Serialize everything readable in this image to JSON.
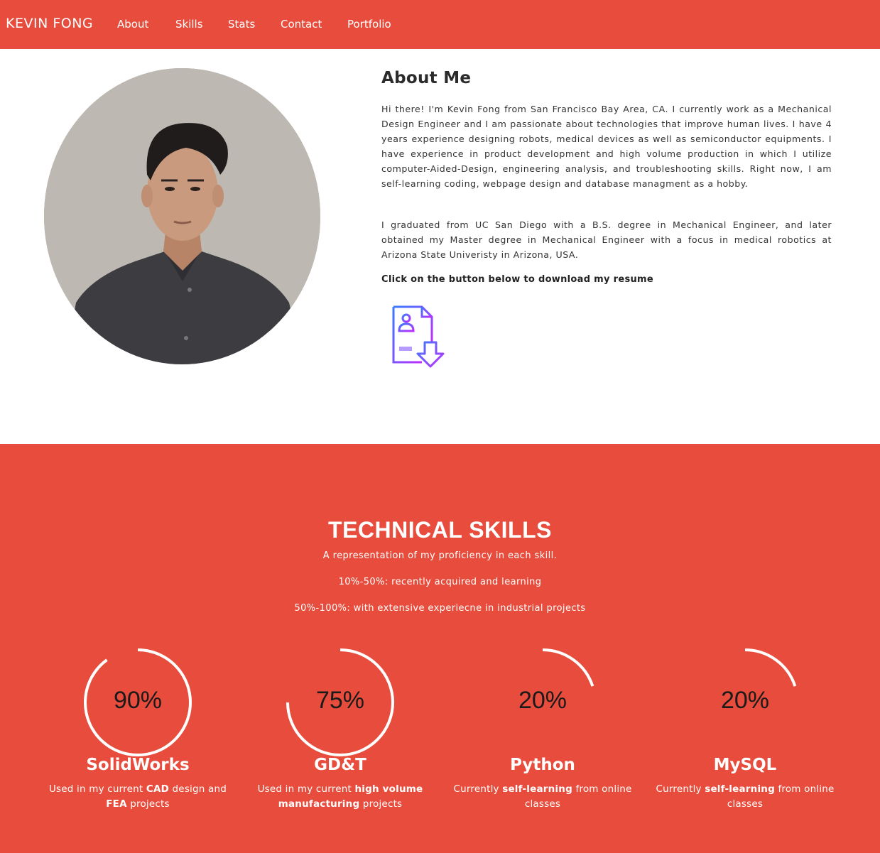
{
  "colors": {
    "accent": "#e74c3c",
    "text": "#333333",
    "white": "#ffffff"
  },
  "nav": {
    "brand": "KEVIN FONG",
    "links": [
      "About",
      "Skills",
      "Stats",
      "Contact",
      "Portfolio"
    ]
  },
  "about": {
    "title": "About Me",
    "paragraph1": "Hi there! I'm Kevin Fong from San Francisco Bay Area, CA. I currently work as a Mechanical Design Engineer and I am passionate about technologies that improve human lives. I have 4 years experience designing robots, medical devices as well as semiconductor equipments. I have experience in product development and high volume production in which I utilize computer-Aided-Design, engineering analysis, and troubleshooting skills. Right now, I am self-learning coding, webpage design and database managment as a hobby.",
    "paragraph2": "I graduated from UC San Diego with a B.S. degree in Mechanical Engineer, and later obtained my Master degree in Mechanical Engineer with a focus in medical robotics at Arizona State Univeristy in Arizona, USA.",
    "resume_cta": "Click on the button below to download my resume",
    "resume_icon": "resume-download-icon"
  },
  "skills": {
    "title": "TECHNICAL SKILLS",
    "lines": [
      "A representation of my proficiency in each skill.",
      "10%-50%: recently acquired and learning",
      "50%-100%: with extensive experiecne in industrial projects"
    ],
    "items": [
      {
        "name": "SolidWorks",
        "percent": "90%",
        "level": 0.9,
        "desc": [
          {
            "t": "Used in my current "
          },
          {
            "t": "CAD",
            "b": true
          },
          {
            "t": " design and "
          },
          {
            "t": "FEA",
            "b": true
          },
          {
            "t": " projects"
          }
        ]
      },
      {
        "name": "GD&T",
        "percent": "75%",
        "level": 0.75,
        "desc": [
          {
            "t": "Used in my current "
          },
          {
            "t": "high volume manufacturing",
            "b": true
          },
          {
            "t": " projects"
          }
        ]
      },
      {
        "name": "Python",
        "percent": "20%",
        "level": 0.2,
        "desc": [
          {
            "t": "Currently "
          },
          {
            "t": "self-learning",
            "b": true
          },
          {
            "t": " from online classes"
          }
        ]
      },
      {
        "name": "MySQL",
        "percent": "20%",
        "level": 0.2,
        "desc": [
          {
            "t": "Currently "
          },
          {
            "t": "self-learning",
            "b": true
          },
          {
            "t": " from online classes"
          }
        ]
      }
    ]
  }
}
